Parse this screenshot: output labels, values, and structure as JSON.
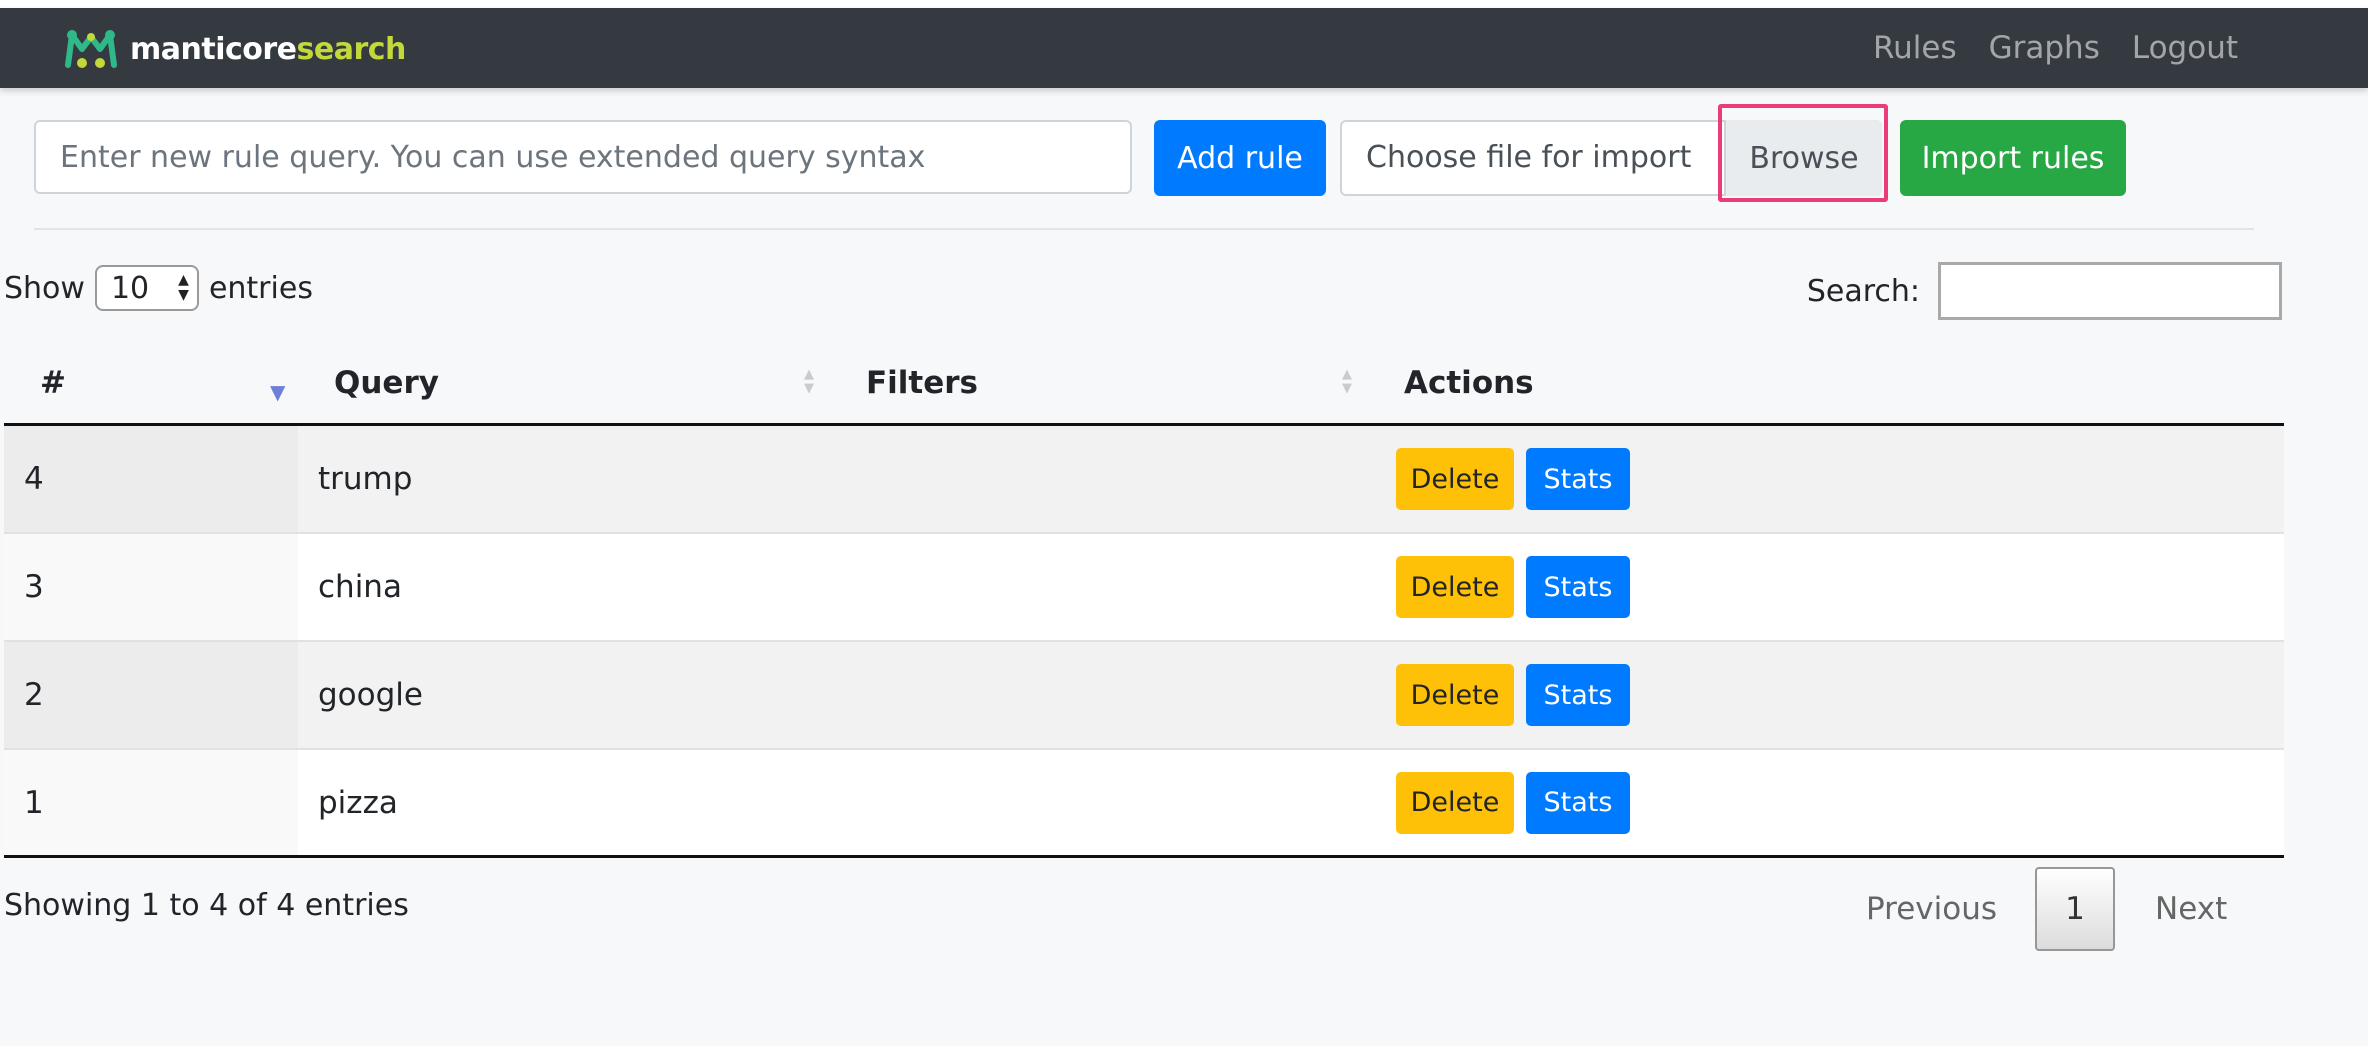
{
  "navbar": {
    "brand_primary": "manticore",
    "brand_secondary": "search",
    "links": [
      "Rules",
      "Graphs",
      "Logout"
    ]
  },
  "toolbar": {
    "query_placeholder": "Enter new rule query. You can use extended query syntax",
    "add_rule_label": "Add rule",
    "file_label": "Choose file for import",
    "browse_label": "Browse",
    "import_label": "Import rules"
  },
  "table_controls": {
    "show_label": "Show",
    "page_length": "10",
    "entries_label": "entries",
    "search_label": "Search:"
  },
  "table": {
    "columns": [
      "#",
      "Query",
      "Filters",
      "Actions"
    ],
    "rows": [
      {
        "id": "4",
        "query": "trump",
        "filters": ""
      },
      {
        "id": "3",
        "query": "china",
        "filters": ""
      },
      {
        "id": "2",
        "query": "google",
        "filters": ""
      },
      {
        "id": "1",
        "query": "pizza",
        "filters": ""
      }
    ],
    "delete_label": "Delete",
    "stats_label": "Stats"
  },
  "footer": {
    "info": "Showing 1 to 4 of 4 entries",
    "previous": "Previous",
    "current_page": "1",
    "next": "Next"
  },
  "colors": {
    "navbar": "#343a40",
    "primary": "#007bff",
    "success": "#28a745",
    "warning": "#ffc107",
    "brand_accent": "#c3d93a",
    "highlight": "#ea3c7a"
  }
}
